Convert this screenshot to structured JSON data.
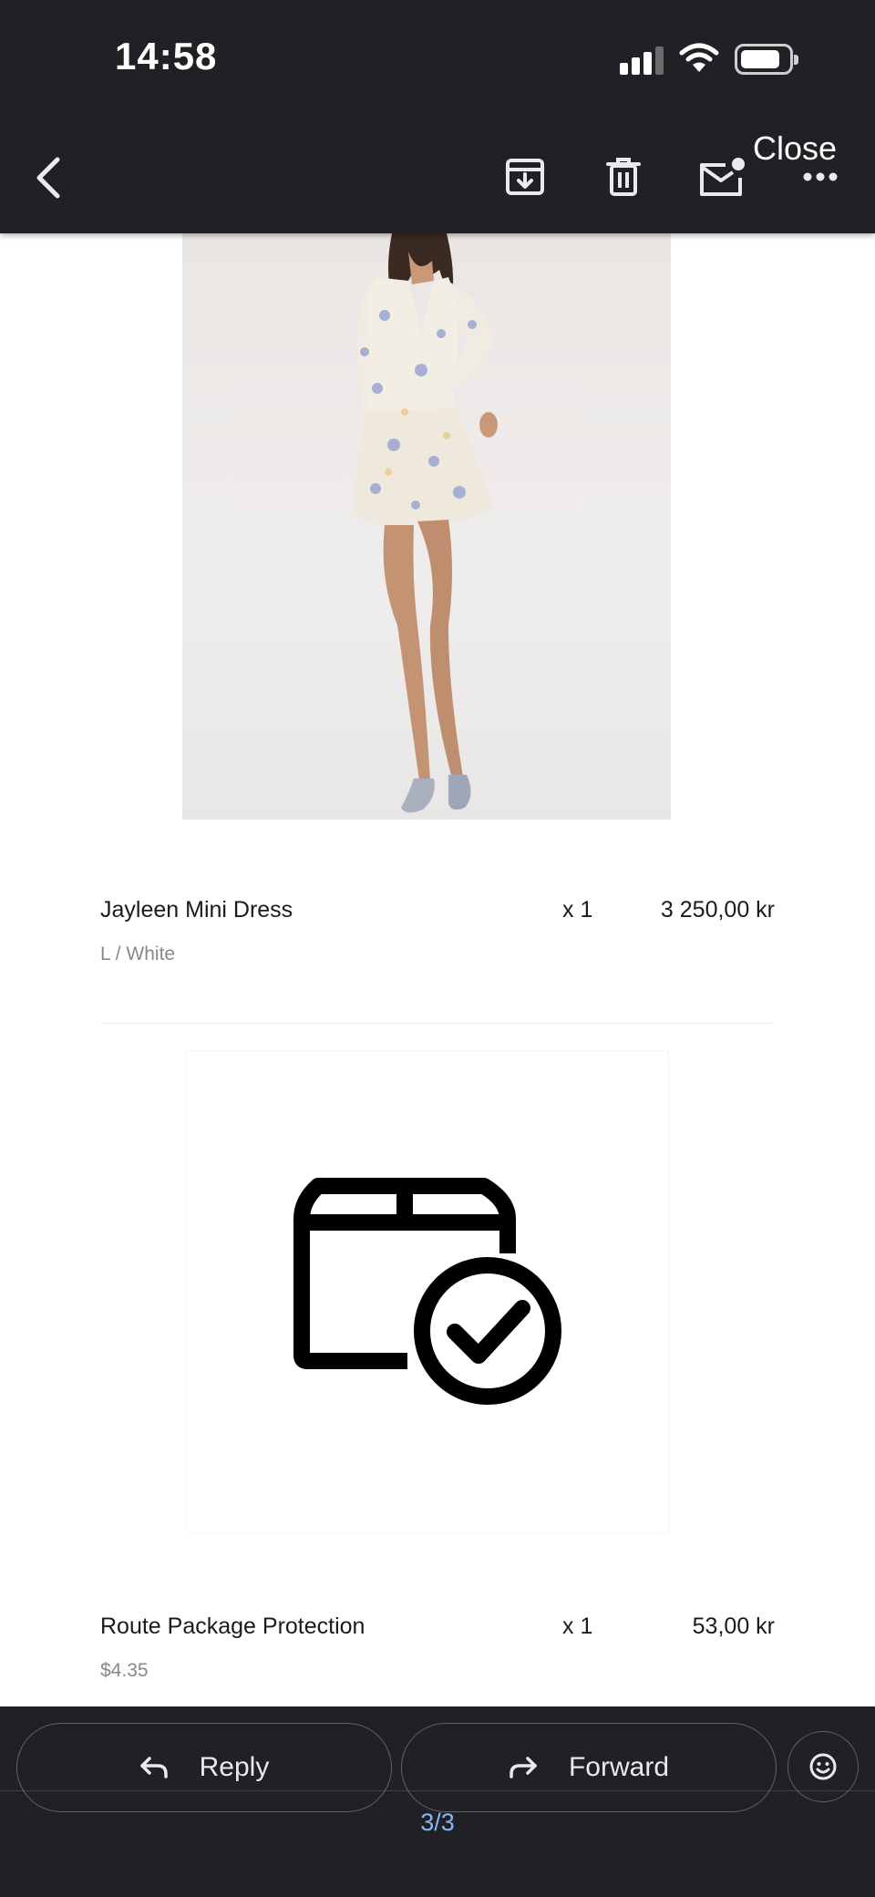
{
  "status_bar": {
    "time": "14:58",
    "icons": [
      "signal-icon",
      "wifi-icon",
      "battery-icon"
    ]
  },
  "toolbar": {
    "icons": [
      "back-arrow-icon",
      "archive-icon",
      "trash-icon",
      "mark-unread-icon",
      "more-dots-icon"
    ],
    "close_label": "Close"
  },
  "items": [
    {
      "name": "Jayleen Mini Dress",
      "quantity": "x 1",
      "price": "3 250,00 kr",
      "variant": "L / White",
      "image": "product-photo-floral-mini-dress"
    },
    {
      "name": "Route Package Protection",
      "quantity": "x 1",
      "price": "53,00 kr",
      "variant": "$4.35",
      "image": "package-check-icon"
    }
  ],
  "actions": {
    "reply_label": "Reply",
    "forward_label": "Forward",
    "emoji_icon": "emoji-react-icon"
  },
  "page_indicator": "3/3",
  "colors": {
    "bar_background": "#202124",
    "page_indicator": "#8ab4f8",
    "secondary_text": "#888888"
  }
}
